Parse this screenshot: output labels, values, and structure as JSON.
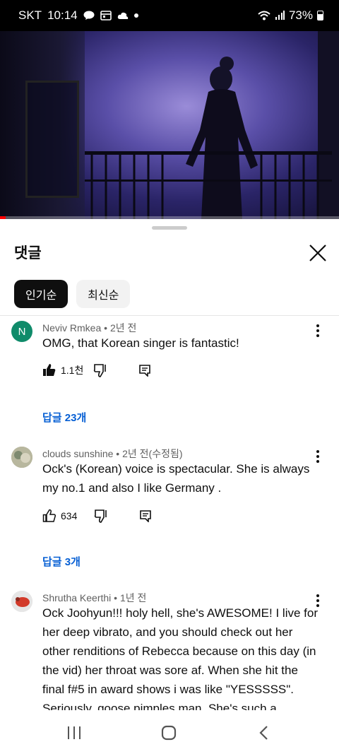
{
  "status_bar": {
    "carrier": "SKT",
    "time": "10:14",
    "battery": "73%"
  },
  "sheet": {
    "title": "댓글"
  },
  "chips": [
    {
      "label": "인기순",
      "active": true
    },
    {
      "label": "최신순",
      "active": false
    }
  ],
  "comments": [
    {
      "avatar_letter": "N",
      "avatar_color": "#0f8b6a",
      "author": "Neviv Rmkea",
      "time": "2년 전",
      "text": "OMG, that Korean singer is fantastic!",
      "likes": "1.1천",
      "liked": true,
      "replies": "답글 23개"
    },
    {
      "avatar_letter": "",
      "avatar_color": "#a7a88e",
      "author": "clouds sunshine",
      "time": "2년 전(수정됨)",
      "text": "Ock's (Korean) voice is spectacular. She is always my no.1 and also I like Germany .",
      "likes": "634",
      "liked": false,
      "replies": "답글 3개"
    },
    {
      "avatar_letter": "",
      "avatar_color": "#d9d9d9",
      "author": "Shrutha Keerthi",
      "time": "1년 전",
      "text": "Ock Joohyun!!! holy hell, she's AWESOME! I live for her deep vibrato, and you should check out her other renditions of Rebecca because on this day (in the vid) her throat was sore af. When she hit the final f#5 in award shows i was like \"YESSSSS\". Seriously, goose pimples man. She's such a"
    }
  ],
  "icons": {
    "close": "close-icon",
    "more": "more-vert-icon",
    "like": "thumb-up-icon",
    "dislike": "thumb-down-icon",
    "reply": "comment-icon"
  },
  "colors": {
    "accent": "#065fd4",
    "active_chip": "#0f0f0f",
    "progress": "#ff0000"
  }
}
